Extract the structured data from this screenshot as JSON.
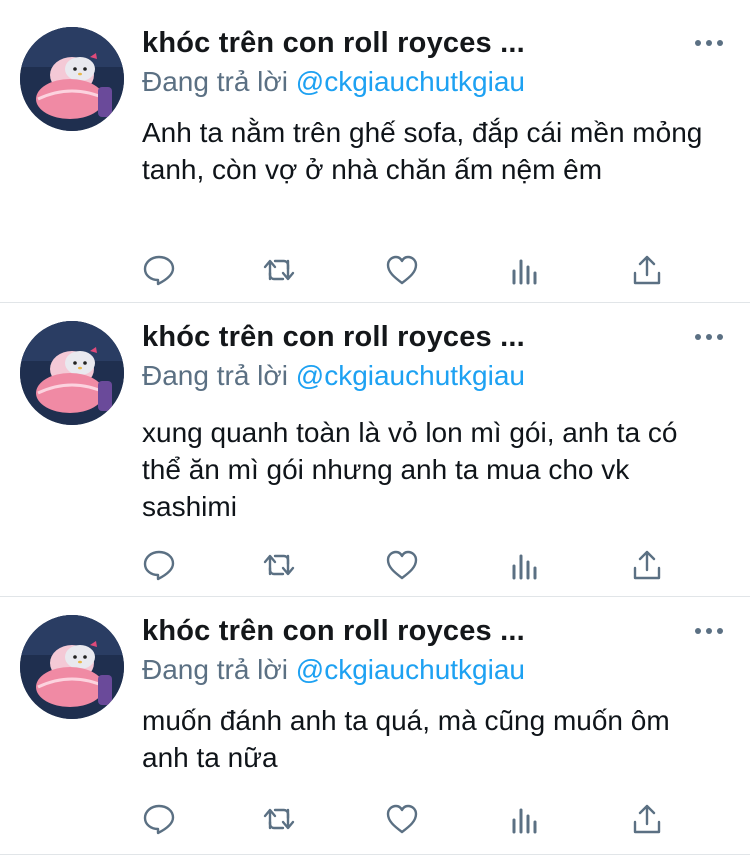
{
  "tweets": [
    {
      "author": "khóc trên con roll royces ...",
      "reply_prefix": "Đang trả lời",
      "reply_handle": "@ckgiauchutkgiau",
      "text": "Anh ta nằm trên ghế sofa, đắp cái mền mỏng tanh, còn vợ ở nhà chăn ấm nệm êm"
    },
    {
      "author": "khóc trên con roll royces ...",
      "reply_prefix": "Đang trả lời",
      "reply_handle": "@ckgiauchutkgiau",
      "text": "xung quanh toàn là vỏ lon mì gói, anh ta có thể ăn mì gói nhưng anh ta mua cho vk sashimi"
    },
    {
      "author": "khóc trên con roll royces ...",
      "reply_prefix": "Đang trả lời",
      "reply_handle": "@ckgiauchutkgiau",
      "text": "muốn đánh anh ta quá, mà cũng muốn ôm anh ta nữa"
    }
  ],
  "icons": {
    "more": "more-horizontal-icon",
    "reply": "reply-bubble-icon",
    "retweet": "retweet-icon",
    "like": "heart-icon",
    "analytics": "analytics-bars-icon",
    "share": "share-upload-icon"
  },
  "colors": {
    "link": "#1da1f2",
    "secondary_text": "#5b7083",
    "icon": "#5b7083",
    "divider": "#e1e5e8"
  }
}
